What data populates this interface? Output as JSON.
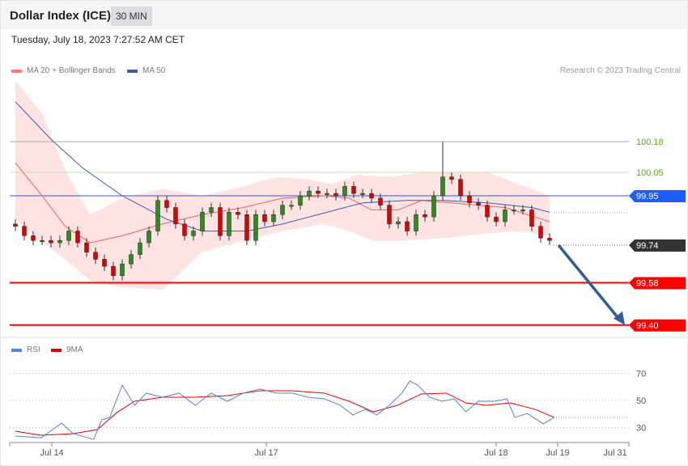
{
  "header": {
    "title": "Dollar Index (ICE)",
    "timeframe": "30 MIN",
    "datetime": "Tuesday, July 18, 2023 7:27:52 AM CET"
  },
  "legend": {
    "ma20": "MA 20 + Bollinger Bands",
    "ma50": "MA 50",
    "rsi": "RSI",
    "rsi_ma": "9MA",
    "credit": "Research © 2023 Trading Central"
  },
  "colors": {
    "up": "#2e8b1e",
    "down": "#e00000",
    "ma20": "#f06060",
    "ma50": "#3a5ea8",
    "band": "#ffe2e2",
    "rsi": "#5b7fd6",
    "rsi_ma": "#e00000"
  },
  "chart_data": [
    {
      "type": "candlestick",
      "title": "Dollar Index (ICE) 30 MIN",
      "closes": [
        99.82,
        99.78,
        99.76,
        99.76,
        99.75,
        99.76,
        99.8,
        99.75,
        99.71,
        99.68,
        99.65,
        99.61,
        99.66,
        99.7,
        99.75,
        99.8,
        99.93,
        99.9,
        99.83,
        99.78,
        99.8,
        99.88,
        99.9,
        99.78,
        99.88,
        99.87,
        99.76,
        99.87,
        99.84,
        99.87,
        99.91,
        99.91,
        99.95,
        99.97,
        99.96,
        99.96,
        99.95,
        99.99,
        99.96,
        99.96,
        99.94,
        99.91,
        99.83,
        99.84,
        99.8,
        99.87,
        99.86,
        99.95,
        100.03,
        100.02,
        99.95,
        99.92,
        99.91,
        99.86,
        99.84,
        99.89,
        99.89,
        99.89,
        99.82,
        99.77,
        99.76
      ],
      "spike_high": {
        "index": 48,
        "value": 100.18
      },
      "ma50": [
        [
          0,
          100.35
        ],
        [
          4,
          100.19
        ],
        [
          7.5,
          100.07
        ],
        [
          12,
          99.95
        ],
        [
          17,
          99.85
        ],
        [
          21,
          99.8
        ],
        [
          26,
          99.8
        ],
        [
          30,
          99.83
        ],
        [
          35,
          99.88
        ],
        [
          37,
          99.9
        ],
        [
          39,
          99.92
        ],
        [
          44,
          99.93
        ],
        [
          48,
          99.93
        ],
        [
          53,
          99.92
        ],
        [
          58,
          99.9
        ],
        [
          60,
          99.88
        ]
      ],
      "ma20": [
        [
          0,
          100.09
        ],
        [
          3,
          99.95
        ],
        [
          5.6,
          99.82
        ],
        [
          8.4,
          99.75
        ],
        [
          12,
          99.78
        ],
        [
          16.5,
          99.83
        ],
        [
          21,
          99.87
        ],
        [
          25.6,
          99.9
        ],
        [
          30,
          99.94
        ],
        [
          34.7,
          99.95
        ],
        [
          37.5,
          99.94
        ],
        [
          40,
          99.89
        ],
        [
          43,
          99.89
        ],
        [
          45.6,
          99.93
        ],
        [
          49,
          99.92
        ],
        [
          55,
          99.9
        ],
        [
          60,
          99.84
        ]
      ],
      "bb_upper": [
        [
          0,
          100.44
        ],
        [
          3,
          100.3
        ],
        [
          5.6,
          100.06
        ],
        [
          8.4,
          99.87
        ],
        [
          12,
          99.94
        ],
        [
          16.5,
          99.98
        ],
        [
          21,
          99.95
        ],
        [
          25.6,
          99.99
        ],
        [
          29.3,
          100.03
        ],
        [
          33,
          100.02
        ],
        [
          35.5,
          100.0
        ],
        [
          38.4,
          100.04
        ],
        [
          42,
          100.03
        ],
        [
          45.6,
          100.05
        ],
        [
          49,
          100.05
        ],
        [
          53,
          100.05
        ],
        [
          56.5,
          100.0
        ],
        [
          60,
          99.95
        ]
      ],
      "bb_lower": [
        [
          0,
          99.85
        ],
        [
          3,
          99.75
        ],
        [
          5.6,
          99.68
        ],
        [
          8.4,
          99.59
        ],
        [
          12,
          99.56
        ],
        [
          16.5,
          99.55
        ],
        [
          21,
          99.71
        ],
        [
          25.6,
          99.76
        ],
        [
          30,
          99.8
        ],
        [
          34.7,
          99.83
        ],
        [
          37.5,
          99.8
        ],
        [
          40,
          99.76
        ],
        [
          44,
          99.76
        ],
        [
          48.4,
          99.77
        ],
        [
          53,
          99.79
        ],
        [
          56.5,
          99.8
        ],
        [
          60,
          99.78
        ]
      ],
      "levels": [
        {
          "value": 100.18,
          "label": "100.18",
          "color": "#5aa820",
          "style": "text"
        },
        {
          "value": 100.05,
          "label": "100.05",
          "color": "#5aa820",
          "style": "text"
        },
        {
          "value": 99.95,
          "label": "99.95",
          "color": "#1e5ef5",
          "style": "tag"
        },
        {
          "value": 99.74,
          "label": "99.74",
          "color": "#333333",
          "style": "tag"
        },
        {
          "value": 99.58,
          "label": "99.58",
          "color": "#ff0000",
          "style": "tag"
        },
        {
          "value": 99.4,
          "label": "99.40",
          "color": "#ff0000",
          "style": "tag"
        }
      ],
      "projection": {
        "from": 99.74,
        "to": 99.4
      }
    },
    {
      "type": "line",
      "title": "RSI",
      "ylim": [
        15,
        80
      ],
      "yticks": [
        70,
        50,
        30
      ],
      "rsi": [
        [
          0,
          23.7
        ],
        [
          2.9,
          22.5
        ],
        [
          5.2,
          33.3
        ],
        [
          6.5,
          25.5
        ],
        [
          8.8,
          21.3
        ],
        [
          9.7,
          35.7
        ],
        [
          10.6,
          37.5
        ],
        [
          12,
          61.3
        ],
        [
          13.4,
          46.4
        ],
        [
          14.7,
          55.4
        ],
        [
          16.5,
          52.4
        ],
        [
          18.4,
          55.4
        ],
        [
          20.2,
          46.4
        ],
        [
          22,
          55.4
        ],
        [
          23.8,
          49.4
        ],
        [
          25.6,
          55.4
        ],
        [
          27.5,
          58.4
        ],
        [
          29.3,
          55.4
        ],
        [
          31.1,
          55.4
        ],
        [
          32.9,
          52.4
        ],
        [
          34.7,
          51.2
        ],
        [
          36.5,
          46.4
        ],
        [
          37.9,
          39.3
        ],
        [
          39.3,
          43.4
        ],
        [
          40.6,
          39.3
        ],
        [
          42,
          46.4
        ],
        [
          43.4,
          55.4
        ],
        [
          44.3,
          64.3
        ],
        [
          45.2,
          61.3
        ],
        [
          46.5,
          52.4
        ],
        [
          47.9,
          49.4
        ],
        [
          49.3,
          51.2
        ],
        [
          50.6,
          41.6
        ],
        [
          52,
          49.4
        ],
        [
          53.8,
          49.4
        ],
        [
          55.2,
          51.2
        ],
        [
          56.1,
          37.5
        ],
        [
          57.5,
          40.4
        ],
        [
          59.3,
          32.7
        ],
        [
          60.5,
          37.5
        ]
      ],
      "ma9": [
        [
          0,
          27.3
        ],
        [
          2.9,
          24.3
        ],
        [
          6.5,
          25.5
        ],
        [
          9.2,
          28.5
        ],
        [
          11.5,
          41.6
        ],
        [
          13.4,
          49.4
        ],
        [
          16.5,
          52.4
        ],
        [
          20.2,
          52.4
        ],
        [
          23.8,
          53.6
        ],
        [
          27.5,
          57.2
        ],
        [
          31.1,
          57.2
        ],
        [
          34.7,
          55.4
        ],
        [
          37.5,
          49.4
        ],
        [
          40.2,
          41.6
        ],
        [
          42.9,
          46.4
        ],
        [
          45.6,
          54.8
        ],
        [
          48.4,
          55.4
        ],
        [
          50.6,
          48.2
        ],
        [
          52.9,
          46.4
        ],
        [
          55.6,
          48.2
        ],
        [
          58.4,
          43.4
        ],
        [
          60.5,
          37.5
        ]
      ],
      "x_labels": [
        "Jul 14",
        "Jul 17",
        "Jul 18",
        "Jul 19",
        "Jul 31"
      ]
    }
  ]
}
